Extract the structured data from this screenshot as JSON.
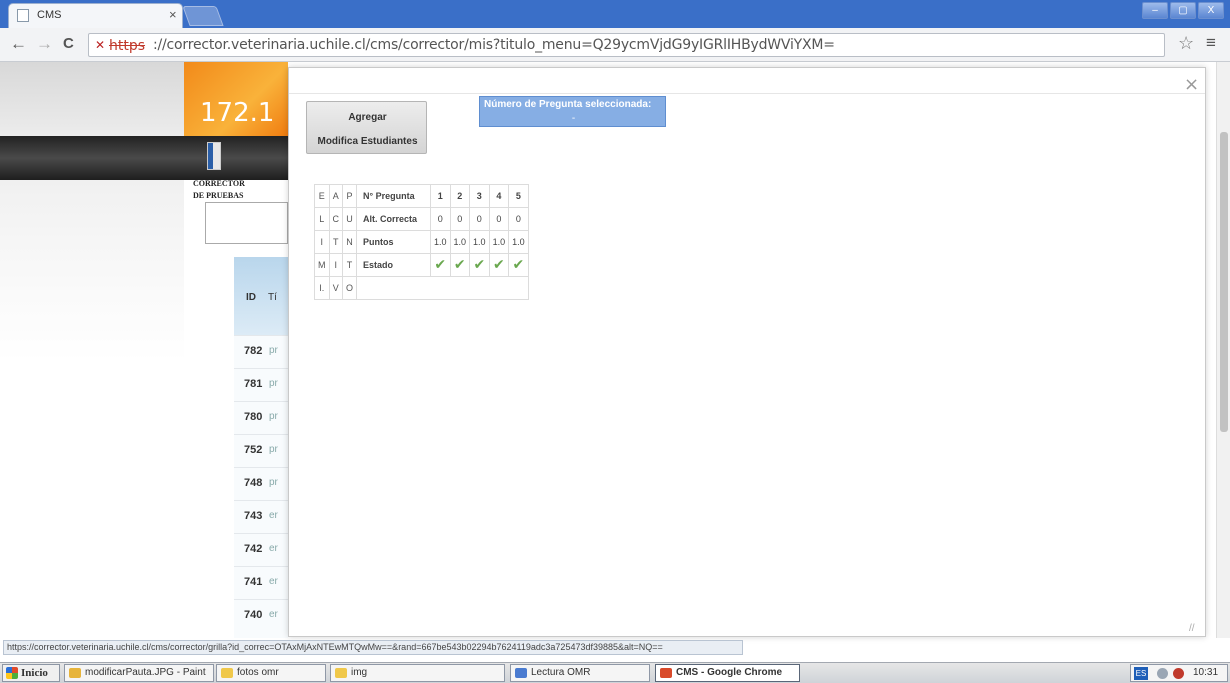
{
  "browser": {
    "tab_title": "CMS",
    "tab_close": "×",
    "window_controls": [
      "–",
      "▢",
      "X"
    ],
    "nav": {
      "back": "←",
      "forward": "→",
      "reload": "C"
    },
    "url_scheme": "https",
    "url_rest": "://corrector.veterinaria.uchile.cl/cms/corrector/mis?titulo_menu=Q29ycmVjdG9yIGRlIHBydWViYXM=",
    "star": "☆",
    "menu": "≡"
  },
  "page": {
    "banner_ip": "172.1",
    "corrector_label_1": "CORRECTOR",
    "corrector_label_2": "DE PRUEBAS",
    "id_header": "ID",
    "col_header": "Tí",
    "rows": [
      {
        "id": "782",
        "txt": "pr"
      },
      {
        "id": "781",
        "txt": "pr"
      },
      {
        "id": "780",
        "txt": "pr"
      },
      {
        "id": "752",
        "txt": "pr"
      },
      {
        "id": "748",
        "txt": "pr"
      },
      {
        "id": "743",
        "txt": "er"
      },
      {
        "id": "742",
        "txt": "er"
      },
      {
        "id": "741",
        "txt": "er"
      },
      {
        "id": "740",
        "txt": "er"
      }
    ]
  },
  "modal": {
    "close": "×",
    "agregar_label": "Agregar",
    "modifica_label": "Modifica Estudiantes",
    "selected_label": "Número de Pregunta seleccionada:",
    "selected_value": "-",
    "grid": {
      "vertical_cols": [
        [
          "E",
          "L",
          "I",
          "M",
          "I."
        ],
        [
          "A",
          "C",
          "T",
          "I",
          "V"
        ],
        [
          "P",
          "U",
          "N",
          "T",
          "O"
        ]
      ],
      "row_labels": [
        "N° Pregunta",
        "Alt. Correcta",
        "Puntos",
        "Estado"
      ],
      "questions": [
        "1",
        "2",
        "3",
        "4",
        "5"
      ],
      "alt_correcta": [
        "0",
        "0",
        "0",
        "0",
        "0"
      ],
      "puntos": [
        "1.0",
        "1.0",
        "1.0",
        "1.0",
        "1.0"
      ],
      "estado": [
        "✔",
        "✔",
        "✔",
        "✔",
        "✔"
      ]
    },
    "resize": "//"
  },
  "status_url": "https://corrector.veterinaria.uchile.cl/cms/corrector/grilla?id_correc=OTAxMjAxNTEwMTQwMw==&rand=667be543b02294b7624119adc3a725473df39885&alt=NQ==",
  "taskbar": {
    "start": "Inicio",
    "tasks": [
      {
        "label": "modificarPauta.JPG - Paint",
        "active": false,
        "color": "#e7b43a"
      },
      {
        "label": "fotos omr",
        "active": false,
        "color": "#f0c84a"
      },
      {
        "label": "img",
        "active": false,
        "color": "#f0c84a"
      },
      {
        "label": "Lectura OMR",
        "active": false,
        "color": "#4a7bd0"
      },
      {
        "label": "CMS - Google Chrome",
        "active": true,
        "color": "#d94a2a"
      }
    ],
    "lang": "ES",
    "clock": "10:31"
  }
}
